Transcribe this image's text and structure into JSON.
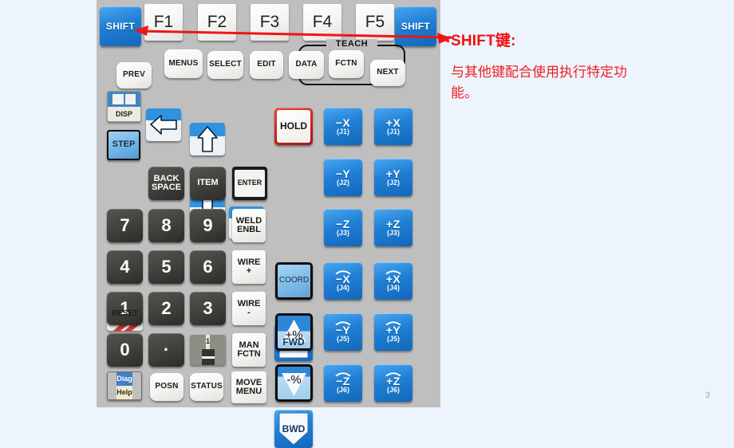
{
  "slide": {
    "page_number": "3",
    "background_color": "#eef4fd",
    "panel_color": "#bfbfbf"
  },
  "annotation": {
    "title": "SHIFT键:",
    "body": "与其他键配合使用执行特定功能。",
    "accent_color": "#ee1111",
    "arrow_icon": "left-arrow-annotation-icon"
  },
  "pendant": {
    "function_row": {
      "shift_left": "SHIFT",
      "shift_right": "SHIFT",
      "f_keys": [
        "F1",
        "F2",
        "F3",
        "F4",
        "F5"
      ]
    },
    "teach_group": {
      "label": "TEACH",
      "keys": [
        "SELECT",
        "EDIT",
        "DATA"
      ]
    },
    "nav_row": {
      "prev": "PREV",
      "menus": "MENUS",
      "fctn": "FCTN",
      "next": "NEXT"
    },
    "display_keys": {
      "disp": "DISP",
      "step": "STEP"
    },
    "arrow_keys": {
      "up": "arrow-up-icon",
      "down": "arrow-down-icon",
      "left": "arrow-left-icon",
      "right": "arrow-right-icon"
    },
    "edit_row": {
      "reset": "RESET",
      "backspace_line1": "BACK",
      "backspace_line2": "SPACE",
      "item": "ITEM",
      "enter": "ENTER"
    },
    "numpad": [
      [
        "7",
        "8",
        "9"
      ],
      [
        "4",
        "5",
        "6"
      ],
      [
        "1",
        "2",
        "3"
      ],
      [
        "0",
        "·"
      ]
    ],
    "one_minus_key": {
      "top": "1",
      "bottom": "minus-symbol-icon"
    },
    "weld_column": [
      {
        "line1": "WELD",
        "line2": "ENBL"
      },
      {
        "line1": "WIRE",
        "line2": "+"
      },
      {
        "line1": "WIRE",
        "line2": "-"
      },
      {
        "line1": "MAN",
        "line2": "FCTN"
      },
      {
        "line1": "MOVE",
        "line2": "MENU"
      }
    ],
    "bottom_row": {
      "diag": "Diag",
      "help": "Help",
      "posn": "POSN",
      "status": "STATUS"
    },
    "motion_column": {
      "hold": "HOLD",
      "fwd": "FWD",
      "bwd": "BWD",
      "coord": "COORD",
      "speed_up": "+%",
      "speed_down": "-%"
    },
    "jog_keys": {
      "negative": [
        {
          "axis": "−X",
          "joint": "(J1)",
          "rotary": false
        },
        {
          "axis": "−Y",
          "joint": "(J2)",
          "rotary": false
        },
        {
          "axis": "−Z",
          "joint": "(J3)",
          "rotary": false
        },
        {
          "axis": "−X",
          "joint": "(J4)",
          "rotary": true
        },
        {
          "axis": "−Y",
          "joint": "(J5)",
          "rotary": true
        },
        {
          "axis": "−Z",
          "joint": "(J6)",
          "rotary": true
        }
      ],
      "positive": [
        {
          "axis": "+X",
          "joint": "(J1)",
          "rotary": false
        },
        {
          "axis": "+Y",
          "joint": "(J2)",
          "rotary": false
        },
        {
          "axis": "+Z",
          "joint": "(J3)",
          "rotary": false
        },
        {
          "axis": "+X",
          "joint": "(J4)",
          "rotary": true
        },
        {
          "axis": "+Y",
          "joint": "(J5)",
          "rotary": true
        },
        {
          "axis": "+Z",
          "joint": "(J6)",
          "rotary": true
        }
      ]
    }
  }
}
